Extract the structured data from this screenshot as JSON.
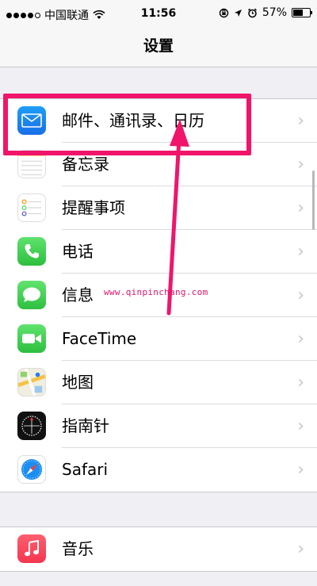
{
  "status_bar": {
    "carrier": "中国联通",
    "time": "11:56",
    "battery_percent": "57%"
  },
  "nav": {
    "title": "设置"
  },
  "group1": [
    {
      "label": "邮件、通讯录、日历",
      "icon": "mail-icon"
    },
    {
      "label": "备忘录",
      "icon": "notes-icon"
    },
    {
      "label": "提醒事项",
      "icon": "reminders-icon"
    },
    {
      "label": "电话",
      "icon": "phone-icon"
    },
    {
      "label": "信息",
      "icon": "messages-icon"
    },
    {
      "label": "FaceTime",
      "icon": "facetime-icon"
    },
    {
      "label": "地图",
      "icon": "maps-icon"
    },
    {
      "label": "指南针",
      "icon": "compass-icon"
    },
    {
      "label": "Safari",
      "icon": "safari-icon"
    }
  ],
  "group2": [
    {
      "label": "音乐",
      "icon": "music-icon"
    }
  ],
  "watermark": "www.qinpinchang.com",
  "colors": {
    "highlight": "#f0156a",
    "background": "#efeff4"
  }
}
